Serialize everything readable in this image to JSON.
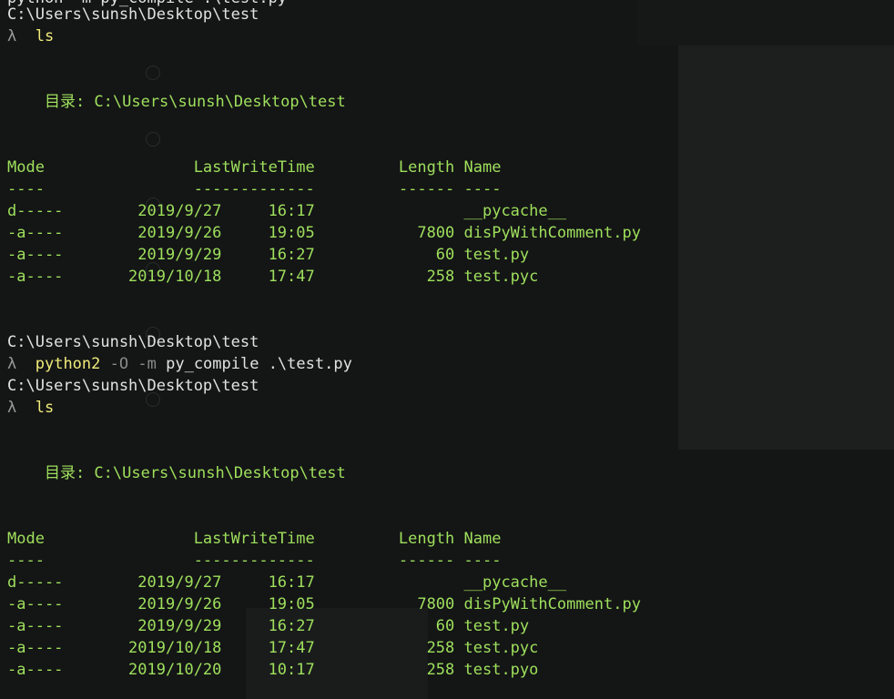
{
  "session": {
    "top_cut": "python -m py_compile .\\test.py",
    "cwd": "C:\\Users\\sunsh\\Desktop\\test",
    "prompt_symbol": "λ",
    "cmd_ls": "ls",
    "cmd_python2": "python2",
    "flag_O": "-O",
    "flag_m": "-m",
    "cmd_args": "py_compile .\\test.py"
  },
  "listing1": {
    "dir_line": "    目录: C:\\Users\\sunsh\\Desktop\\test",
    "header": "Mode                LastWriteTime         Length Name",
    "underline": "----                -------------         ------ ----",
    "rows": [
      "d-----        2019/9/27     16:17                __pycache__",
      "-a----        2019/9/26     19:05           7800 disPyWithComment.py",
      "-a----        2019/9/29     16:27             60 test.py",
      "-a----       2019/10/18     17:47            258 test.pyc"
    ]
  },
  "listing2": {
    "dir_line": "    目录: C:\\Users\\sunsh\\Desktop\\test",
    "header": "Mode                LastWriteTime         Length Name",
    "underline": "----                -------------         ------ ----",
    "rows": [
      "d-----        2019/9/27     16:17                __pycache__",
      "-a----        2019/9/26     19:05           7800 disPyWithComment.py",
      "-a----        2019/9/29     16:27             60 test.py",
      "-a----       2019/10/18     17:47            258 test.pyc",
      "-a----       2019/10/20     10:17            258 test.pyo"
    ]
  },
  "colors": {
    "background": "#141515",
    "path": "#e2e2e2",
    "command": "#f0ec7a",
    "output": "#9ee05c",
    "flag": "#8a8a8a"
  }
}
